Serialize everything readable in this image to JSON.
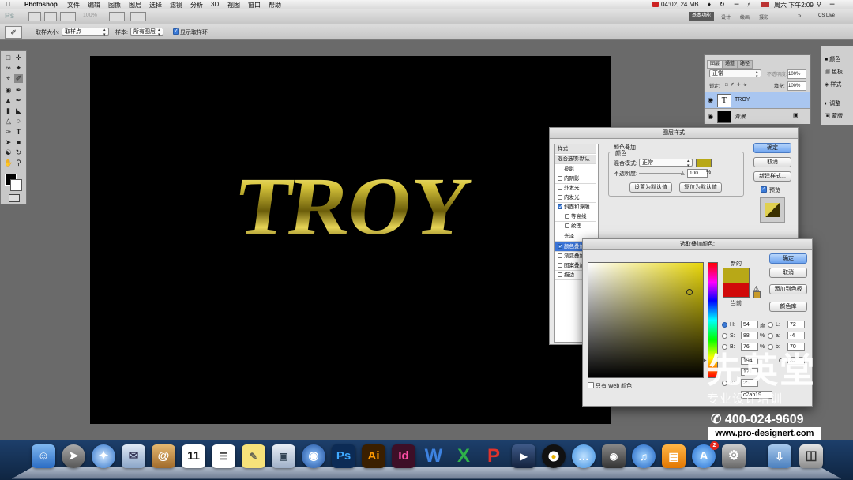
{
  "menubar": {
    "apple": "",
    "app_name": "Photoshop",
    "items": [
      "文件",
      "编辑",
      "图像",
      "图层",
      "选择",
      "滤镜",
      "分析",
      "3D",
      "视图",
      "窗口",
      "帮助"
    ],
    "status": "04:02, 24 MB",
    "clock": "周六 下午2:09"
  },
  "appbar": {
    "ps_badge": "Ps",
    "zoom": "100%",
    "workspace": "基本功能",
    "tabs": [
      "设计",
      "绘画",
      "摄影"
    ],
    "cs_live": "CS Live"
  },
  "options": {
    "sample_size_label": "取样大小:",
    "sample_size_value": "取样点",
    "sample_label": "样本:",
    "sample_value": "所有图层",
    "show_ring_label": "显示取样环"
  },
  "canvas": {
    "text": "TROY"
  },
  "layers_panel": {
    "tabs": [
      "图层",
      "通道",
      "路径"
    ],
    "blend_mode": "正常",
    "opacity_label": "不透明度:",
    "opacity_value": "100%",
    "lock_label": "锁定:",
    "fill_label": "填充:",
    "fill_value": "100%",
    "layers": [
      {
        "name": "TROY",
        "thumb": "T",
        "selected": true
      },
      {
        "name": "背景",
        "thumb": "",
        "selected": false
      }
    ]
  },
  "right_panel": {
    "items": [
      "颜色",
      "色板",
      "样式",
      "调整",
      "蒙版"
    ]
  },
  "layer_style": {
    "title": "图层样式",
    "list_header": "样式",
    "blend_default": "混合选项:默认",
    "effects": [
      {
        "label": "投影",
        "checked": false
      },
      {
        "label": "内阴影",
        "checked": false
      },
      {
        "label": "外发光",
        "checked": false
      },
      {
        "label": "内发光",
        "checked": false
      },
      {
        "label": "斜面和浮雕",
        "checked": true
      },
      {
        "label": "等高线",
        "checked": false
      },
      {
        "label": "纹理",
        "checked": false
      },
      {
        "label": "光泽",
        "checked": false
      },
      {
        "label": "颜色叠加",
        "checked": true
      },
      {
        "label": "渐变叠加",
        "checked": false
      },
      {
        "label": "图案叠加",
        "checked": false
      },
      {
        "label": "描边",
        "checked": false
      }
    ],
    "section_title": "颜色叠加",
    "group_title": "颜色",
    "blend_label": "混合模式:",
    "blend_value": "正常",
    "opacity_label": "不透明度:",
    "opacity_value": "100",
    "percent": "%",
    "btn_set_default": "设置为默认值",
    "btn_reset_default": "复位为默认值",
    "btn_ok": "确定",
    "btn_cancel": "取消",
    "btn_new_style": "新建样式...",
    "preview_label": "预览",
    "overlay_color": "#b8a817"
  },
  "color_picker": {
    "title": "选取叠加颜色:",
    "new_label": "新的",
    "current_label": "当前",
    "new_color": "#b8a817",
    "current_color": "#d10a0a",
    "btn_ok": "确定",
    "btn_cancel": "取消",
    "btn_add_swatch": "添加到色板",
    "btn_library": "颜色库",
    "web_only_label": "只有 Web 颜色",
    "h_label": "H:",
    "h_value": "54",
    "h_unit": "度",
    "s_label": "S:",
    "s_value": "88",
    "s_unit": "%",
    "b_label": "B:",
    "b_value": "76",
    "b_unit": "%",
    "r_value": "194",
    "g_value": "171",
    "bb_label": "B:",
    "bb_value": "25",
    "l_label": "L:",
    "l_value": "72",
    "a_label": "a:",
    "a_value": "-4",
    "b2_label": "b:",
    "b2_value": "70",
    "hex_value": "c2ab19",
    "c_label": "C:",
    "c_value": "32"
  },
  "watermark": {
    "brand": "先英堂",
    "subtitle": "专业设计培训",
    "phone": "400-024-9609",
    "url": "www.pro-designert.com"
  },
  "dock": {
    "calendar_day": "11",
    "app_store_badge": "2",
    "icons": [
      "finder-icon",
      "launchpad-icon",
      "safari-icon",
      "mail-icon",
      "contacts-icon",
      "calendar-icon",
      "reminders-icon",
      "stickies-icon",
      "preview-icon",
      "network-icon",
      "photoshop-icon",
      "illustrator-icon",
      "indesign-icon",
      "word-icon",
      "excel-icon",
      "powerpoint-icon",
      "video-icon",
      "qq-icon",
      "messages-icon",
      "facetime-icon",
      "itunes-icon",
      "ibooks-icon",
      "app-store-icon",
      "system-preferences-icon",
      "downloads-icon",
      "trash-icon"
    ],
    "ps_label": "Ps",
    "ai_label": "Ai",
    "id_label": "Id",
    "w_label": "W",
    "x_label": "X",
    "p_label": "P"
  }
}
